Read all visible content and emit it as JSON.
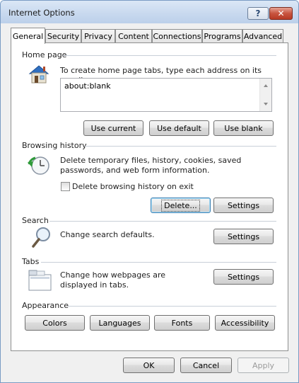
{
  "window": {
    "title": "Internet Options",
    "help_label": "?",
    "close_label": "✕"
  },
  "tabs": [
    {
      "label": "General"
    },
    {
      "label": "Security"
    },
    {
      "label": "Privacy"
    },
    {
      "label": "Content"
    },
    {
      "label": "Connections"
    },
    {
      "label": "Programs"
    },
    {
      "label": "Advanced"
    }
  ],
  "active_tab": "General",
  "home_page": {
    "heading": "Home page",
    "description": "To create home page tabs, type each address on its own line.",
    "value": "about:blank",
    "buttons": {
      "use_current": "Use current",
      "use_default": "Use default",
      "use_blank": "Use blank"
    }
  },
  "browsing_history": {
    "heading": "Browsing history",
    "description": "Delete temporary files, history, cookies, saved passwords, and web form information.",
    "checkbox_label": "Delete browsing history on exit",
    "checkbox_checked": false,
    "delete_label": "Delete...",
    "settings_label": "Settings"
  },
  "search": {
    "heading": "Search",
    "description": "Change search defaults.",
    "settings_label": "Settings"
  },
  "tabs_section": {
    "heading": "Tabs",
    "description": "Change how webpages are displayed in tabs.",
    "settings_label": "Settings"
  },
  "appearance": {
    "heading": "Appearance",
    "buttons": {
      "colors": "Colors",
      "languages": "Languages",
      "fonts": "Fonts",
      "accessibility": "Accessibility"
    }
  },
  "footer": {
    "ok": "OK",
    "cancel": "Cancel",
    "apply": "Apply"
  }
}
